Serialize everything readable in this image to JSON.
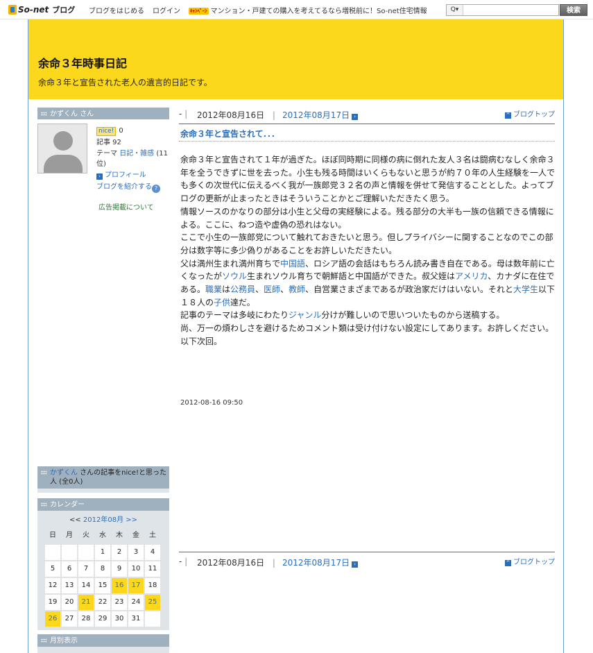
{
  "topbar": {
    "logo_text": "So-net",
    "logo_blog": "ブログ",
    "start_blog": "ブログをはじめる",
    "login": "ログイン",
    "promo_badge": "ｷｬﾝﾍﾟｰﾝ",
    "promo_text": "マンション・戸建ての購入を考えてるなら増税前に！So-net住宅情報",
    "search_scope": "Q▾",
    "search_placeholder": "",
    "search_button": "検索"
  },
  "header": {
    "title": "余命３年時事日記",
    "description": "余命３年と宣告された老人の遺言的日記です。"
  },
  "sidebar": {
    "profile_head_user": "かずくん",
    "profile_head_suffix": " さん",
    "nice_label": "nice!",
    "nice_count": "0",
    "articles_label": "記事 92",
    "theme_prefix": "テーマ ",
    "theme_link": "日記・雑感",
    "theme_rank": " (11位)",
    "profile_link": "プロフィール",
    "introduce_link": "ブログを紹介する",
    "ad_link": "広告掲載について",
    "nice_head_user": "かずくん",
    "nice_head_rest": " さんの記事をnice!と思った人 (全0人)",
    "calendar_head": "カレンダー",
    "monthly_head": "月別表示",
    "calendar": {
      "prev": "<<",
      "month": "2012年08月",
      "next": ">>",
      "dow": [
        "日",
        "月",
        "火",
        "水",
        "木",
        "金",
        "土"
      ],
      "cells": [
        "",
        "",
        "",
        "1",
        "2",
        "3",
        "4",
        "5",
        "6",
        "7",
        "8",
        "9",
        "10",
        "11",
        "12",
        "13",
        "14",
        "15",
        "16",
        "17",
        "18",
        "19",
        "20",
        "21",
        "22",
        "23",
        "24",
        "25",
        "26",
        "27",
        "28",
        "29",
        "30",
        "31",
        ""
      ],
      "post_days": [
        "16",
        "17",
        "21",
        "25",
        "26"
      ]
    }
  },
  "article": {
    "nav_dash": "-",
    "prev_date": "2012年08月16日",
    "next_date": "2012年08月17日",
    "blog_top": "ブログトップ",
    "title": "余命３年と宣告されて．．．",
    "paragraphs": [
      [
        {
          "t": "余命３年と宣告されて１年が過ぎた。ほぼ同時期に同様の病に倒れた友人３名は闘病むなしく余命３年を全うできずに世を去った。小生も残る時間はいくらもないと思うが約７０年の人生経験を一人でも多くの次世代に伝えるべく我が一族郎党３２名の声と情報を併せて発信することとした。よってブログの更新が止まったときはそういうことかとご理解いただきたく思う。"
        }
      ],
      [
        {
          "t": "情報ソースのかなりの部分は小生と父母の実経験による。残る部分の大半も一族の信頼できる情報による。ここに、ねつ造や虚偽の恐れはない。"
        }
      ],
      [
        {
          "t": "ここで小生の一族郎党について触れておきたいと思う。但しプライバシーに関することなのでこの部分は数字等に多少偽りがあることをお許しいただきたい。"
        }
      ],
      [
        {
          "t": "父は満州生まれ満州育ちで"
        },
        {
          "t": "中国語",
          "link": true
        },
        {
          "t": "、ロシア語の会話はもちろん読み書き自在である。母は数年前に亡くなったが"
        },
        {
          "t": "ソウル",
          "link": true
        },
        {
          "t": "生まれソウル育ちで朝鮮語と中国語ができた。叔父姪は"
        },
        {
          "t": "アメリカ",
          "link": true
        },
        {
          "t": "、カナダに在住である。"
        },
        {
          "t": "職業",
          "link": true
        },
        {
          "t": "は"
        },
        {
          "t": "公務員",
          "link": true
        },
        {
          "t": "、"
        },
        {
          "t": "医師",
          "link": true
        },
        {
          "t": "、"
        },
        {
          "t": "教師",
          "link": true
        },
        {
          "t": "、自営業さまざまであるが政治家だけはいない。それと"
        },
        {
          "t": "大学生",
          "link": true
        },
        {
          "t": "以下１８人の"
        },
        {
          "t": "子供",
          "link": true
        },
        {
          "t": "達だ。"
        }
      ],
      [
        {
          "t": "記事のテーマは多岐にわたり"
        },
        {
          "t": "ジャンル",
          "link": true
        },
        {
          "t": "分けが難しいので思いついたものから送稿する。"
        }
      ],
      [
        {
          "t": "尚、万一の煩わしさを避けるためコメント類は受け付けない設定にしてあります。お許しください。以下次回。"
        }
      ]
    ],
    "posted_at": "2012-08-16 09:50"
  }
}
